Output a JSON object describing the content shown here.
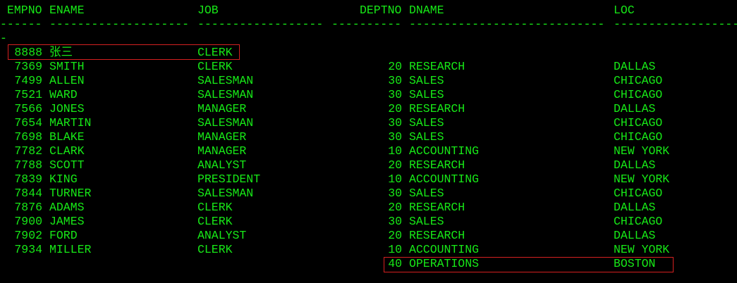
{
  "terminal": {
    "text_color": "#17e817",
    "background": "#000000",
    "highlight_color": "#d42020",
    "columns": [
      "EMPNO",
      "ENAME",
      "JOB",
      "DEPTNO",
      "DNAME",
      "LOC"
    ],
    "separators": [
      "------",
      "--------------------",
      "------------------",
      "----------",
      "----------------------------",
      "------------------"
    ],
    "wrap_char": "-",
    "rows": [
      [
        "8888",
        "张三",
        "CLERK",
        "",
        "",
        ""
      ],
      [
        "7369",
        "SMITH",
        "CLERK",
        "20",
        "RESEARCH",
        "DALLAS"
      ],
      [
        "7499",
        "ALLEN",
        "SALESMAN",
        "30",
        "SALES",
        "CHICAGO"
      ],
      [
        "7521",
        "WARD",
        "SALESMAN",
        "30",
        "SALES",
        "CHICAGO"
      ],
      [
        "7566",
        "JONES",
        "MANAGER",
        "20",
        "RESEARCH",
        "DALLAS"
      ],
      [
        "7654",
        "MARTIN",
        "SALESMAN",
        "30",
        "SALES",
        "CHICAGO"
      ],
      [
        "7698",
        "BLAKE",
        "MANAGER",
        "30",
        "SALES",
        "CHICAGO"
      ],
      [
        "7782",
        "CLARK",
        "MANAGER",
        "10",
        "ACCOUNTING",
        "NEW YORK"
      ],
      [
        "7788",
        "SCOTT",
        "ANALYST",
        "20",
        "RESEARCH",
        "DALLAS"
      ],
      [
        "7839",
        "KING",
        "PRESIDENT",
        "10",
        "ACCOUNTING",
        "NEW YORK"
      ],
      [
        "7844",
        "TURNER",
        "SALESMAN",
        "30",
        "SALES",
        "CHICAGO"
      ],
      [
        "7876",
        "ADAMS",
        "CLERK",
        "20",
        "RESEARCH",
        "DALLAS"
      ],
      [
        "7900",
        "JAMES",
        "CLERK",
        "30",
        "SALES",
        "CHICAGO"
      ],
      [
        "7902",
        "FORD",
        "ANALYST",
        "20",
        "RESEARCH",
        "DALLAS"
      ],
      [
        "7934",
        "MILLER",
        "CLERK",
        "10",
        "ACCOUNTING",
        "NEW YORK"
      ],
      [
        "",
        "",
        "",
        "40",
        "OPERATIONS",
        "BOSTON"
      ]
    ]
  }
}
